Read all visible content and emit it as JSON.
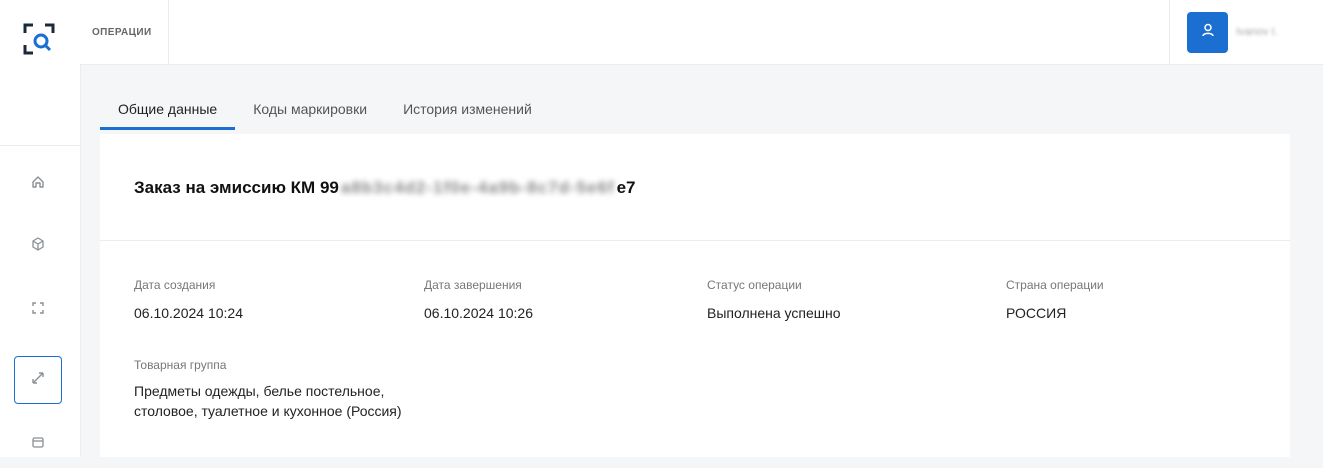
{
  "header": {
    "section_label": "ОПЕРАЦИИ",
    "user_name": "Ivanov I."
  },
  "tabs": [
    {
      "label": "Общие данные",
      "active": true
    },
    {
      "label": "Коды маркировки",
      "active": false
    },
    {
      "label": "История изменений",
      "active": false
    }
  ],
  "order": {
    "title_prefix": "Заказ на эмиссию КМ",
    "id_start": "99",
    "id_hidden": "a8b3c4d2-1f0e-4a9b-8c7d-5e6f",
    "id_end": "e7"
  },
  "fields": {
    "created_label": "Дата создания",
    "created_value": "06.10.2024 10:24",
    "finished_label": "Дата завершения",
    "finished_value": "06.10.2024 10:26",
    "status_label": "Статус операции",
    "status_value": "Выполнена успешно",
    "country_label": "Страна операции",
    "country_value": "РОССИЯ",
    "group_label": "Товарная группа",
    "group_value": "Предметы одежды, белье постельное, столовое, туалетное и кухонное (Россия)"
  },
  "sidebar": {
    "items": [
      "home-icon",
      "package-icon",
      "scan-icon",
      "operations-icon",
      "wallet-icon"
    ],
    "active": "operations-icon"
  },
  "colors": {
    "accent": "#1a6fd1",
    "background": "#f5f6f7",
    "card": "#ffffff"
  }
}
